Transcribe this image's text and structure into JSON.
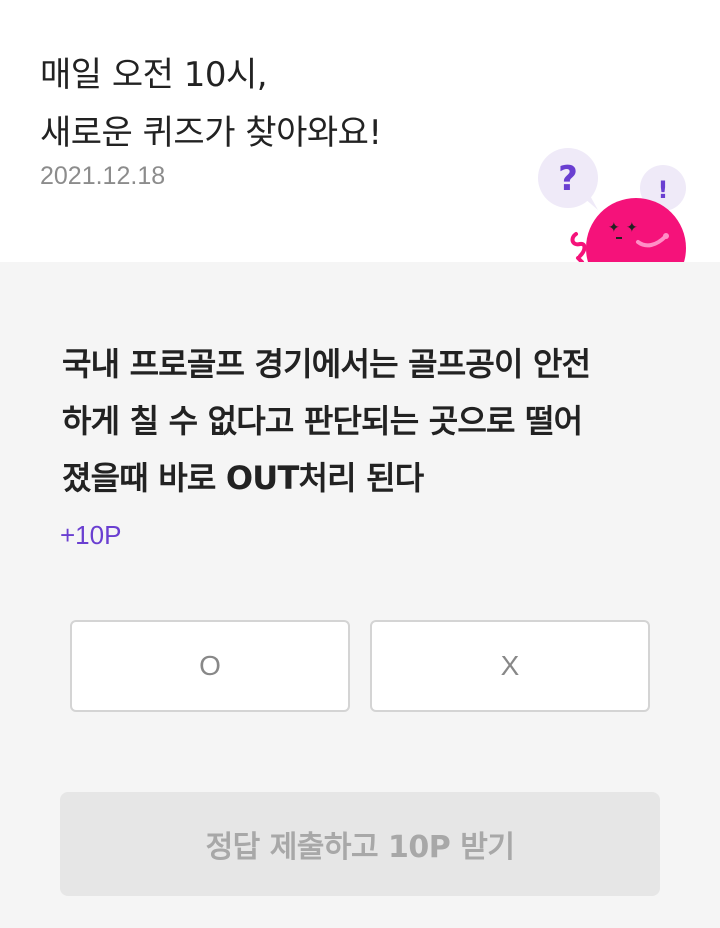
{
  "header": {
    "title_line1": "매일 오전 10시,",
    "title_line2": "새로운 퀴즈가 찾아와요!",
    "date": "2021.12.18"
  },
  "mascot": {
    "question_mark": "?",
    "exclamation_mark": "!",
    "colors": {
      "body": "#f5127a",
      "bubble": "#efeaf8",
      "accent": "#6a3fd1"
    }
  },
  "quiz": {
    "question_line1": "국내 프로골프 경기에서는 골프공이 안전",
    "question_line2": "하게 칠 수 없다고 판단되는 곳으로 떨어",
    "question_line3": "졌을때 바로 OUT처리 된다",
    "points": "+10P",
    "options": {
      "o_label": "O",
      "x_label": "X"
    },
    "submit_label": "정답 제출하고 10P 받기"
  },
  "colors": {
    "accent": "#6a3fd1",
    "background": "#f5f5f5",
    "submit_disabled_bg": "#e6e6e6"
  }
}
